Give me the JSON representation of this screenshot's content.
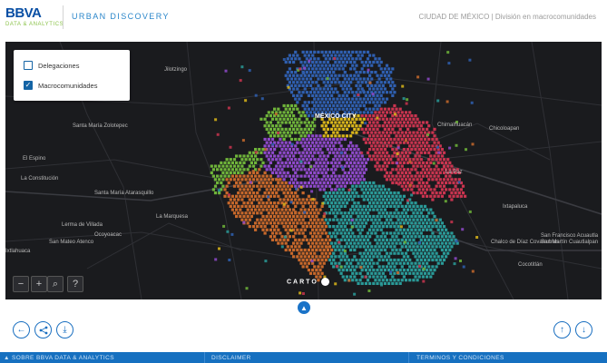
{
  "header": {
    "logo": "BBVA",
    "logo_sub": "DATA & ANALYTICS",
    "app_title": "URBAN DISCOVERY",
    "context": "CIUDAD DE MÉXICO | División en macrocomunidades"
  },
  "legend": {
    "items": [
      {
        "label": "Delegaciones",
        "checked": false
      },
      {
        "label": "Macrocomunidades",
        "checked": true
      }
    ]
  },
  "map": {
    "place_labels": [
      "Jilotzingo",
      "MÉXICO CITY",
      "Chimalhuacán",
      "Chicoloapan",
      "Santa María Zolotepec",
      "El Espino",
      "La Constitución",
      "Santa María Atarasquillo",
      "Lerma de Villada",
      "Ocoyoacac",
      "San Mateo Atenco",
      "La Marquesa",
      "La Paz",
      "Ixtapaluca",
      "San Francisco Acuautla",
      "Chalco de Díaz Covarrubias",
      "San Martín Cuautlalpan",
      "Cocotitlán",
      "Ixtlahuaca"
    ],
    "macro_colors": [
      "#2f5fb0",
      "#6fb43a",
      "#d9b51a",
      "#c9344f",
      "#8e49c9",
      "#c7682b",
      "#2a9a98"
    ],
    "attribution": "CARTO"
  },
  "map_controls": {
    "zoom_out": "−",
    "zoom_in": "+",
    "search": "⌕",
    "info": "?"
  },
  "footer": {
    "about": "▲ SOBRE BBVA DATA & ANALYTICS",
    "disclaimer": "DISCLAIMER",
    "terms": "TERMINOS Y CONDICIONES"
  }
}
